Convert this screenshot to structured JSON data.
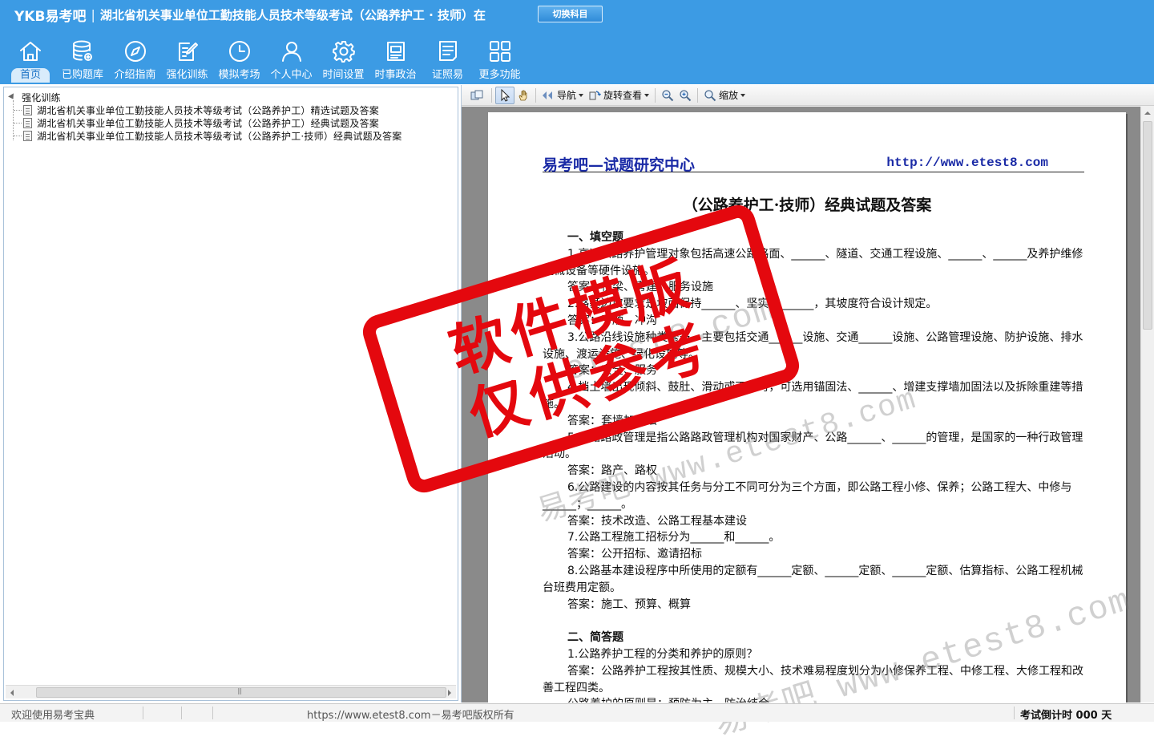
{
  "header": {
    "logo": "YKB易考吧",
    "separator": "|",
    "title": "湖北省机关事业单位工勤技能人员技术等级考试（公路养护工 · 技师）在",
    "switch_button": "切换科目"
  },
  "nav": [
    {
      "label": "首页",
      "icon": "home-icon",
      "active": true
    },
    {
      "label": "已购题库",
      "icon": "database-icon"
    },
    {
      "label": "介绍指南",
      "icon": "compass-icon"
    },
    {
      "label": "强化训练",
      "icon": "edit-icon"
    },
    {
      "label": "模拟考场",
      "icon": "clock-icon"
    },
    {
      "label": "个人中心",
      "icon": "user-icon"
    },
    {
      "label": "时间设置",
      "icon": "gear-icon"
    },
    {
      "label": "时事政治",
      "icon": "book-icon"
    },
    {
      "label": "证照易",
      "icon": "certificate-icon"
    },
    {
      "label": "更多功能",
      "icon": "grid-icon"
    }
  ],
  "tree": {
    "root": "强化训练",
    "items": [
      "湖北省机关事业单位工勤技能人员技术等级考试（公路养护工）精选试题及答案",
      "湖北省机关事业单位工勤技能人员技术等级考试（公路养护工）经典试题及答案",
      "湖北省机关事业单位工勤技能人员技术等级考试（公路养护工·技师）经典试题及答案"
    ]
  },
  "toolbar": {
    "nav": "导航",
    "rotate": "旋转查看",
    "zoom": "缩放"
  },
  "document": {
    "org": "易考吧—试题研究中心",
    "url": "http://www.etest8.com",
    "title": "（公路养护工·技师）经典试题及答案",
    "lines": [
      {
        "text": "一、填空题",
        "type": "sec"
      },
      {
        "text": "1.高速公路养护管理对象包括高速公路路面、______、隧道、交通工程设施、______、______及养护维修机械设备等硬件设施。",
        "type": "p"
      },
      {
        "text": "答案：桥梁、房建、服务设施",
        "type": "p"
      },
      {
        "text": "2.路基边坡要求是坡面保持______、坚实无______，其坡度符合设计规定。",
        "type": "p"
      },
      {
        "text": "答案：平顺、冲沟",
        "type": "p"
      },
      {
        "text": "3.公路沿线设施种类繁多，主要包括交通______设施、交通______设施、公路管理设施、防护设施、排水设施、渡运设施、绿化设施等。",
        "type": "p"
      },
      {
        "text": "答案：安全、服务",
        "type": "p"
      },
      {
        "text": "4.挡土墙出现倾斜、鼓肚、滑动或下沉时，可选用锚固法、______、增建支撑墙加固法以及拆除重建等措施。",
        "type": "p"
      },
      {
        "text": "答案：套墙加固法",
        "type": "p"
      },
      {
        "text": "5.公路路政管理是指公路路政管理机构对国家财产、公路______、______的管理，是国家的一种行政管理活动。",
        "type": "p"
      },
      {
        "text": "答案：路产、路权",
        "type": "p"
      },
      {
        "text": "6.公路建设的内容按其任务与分工不同可分为三个方面，即公路工程小修、保养；公路工程大、中修与______；______。",
        "type": "p"
      },
      {
        "text": "答案：技术改造、公路工程基本建设",
        "type": "p"
      },
      {
        "text": "7.公路工程施工招标分为______和______。",
        "type": "p"
      },
      {
        "text": "答案：公开招标、邀请招标",
        "type": "p"
      },
      {
        "text": "8.公路基本建设程序中所使用的定额有______定额、______定额、______定额、估算指标、公路工程机械台班费用定额。",
        "type": "p"
      },
      {
        "text": "答案：施工、预算、概算",
        "type": "p"
      },
      {
        "text": "",
        "type": "gap"
      },
      {
        "text": "二、简答题",
        "type": "sec"
      },
      {
        "text": "1.公路养护工程的分类和养护的原则？",
        "type": "p"
      },
      {
        "text": "答案：公路养护工程按其性质、规模大小、技术难易程度划分为小修保养工程、中修工程、大修工程和改善工程四类。",
        "type": "p"
      },
      {
        "text": "公路养护的原则是：预防为主、防治结合。",
        "type": "p"
      }
    ],
    "watermark": "易考吧 www.etest8.com",
    "watermark2": "etest8.com",
    "stamp_line1": "软件模版",
    "stamp_line2": "仅供参考"
  },
  "status": {
    "welcome": "欢迎使用易考宝典",
    "copyright": "https://www.etest8.com－易考吧版权所有",
    "countdown": "考试倒计时 000 天"
  },
  "colors": {
    "header_bg": "#3c9be4",
    "doc_blue": "#1a2aa6",
    "stamp_red": "#e4080e"
  }
}
